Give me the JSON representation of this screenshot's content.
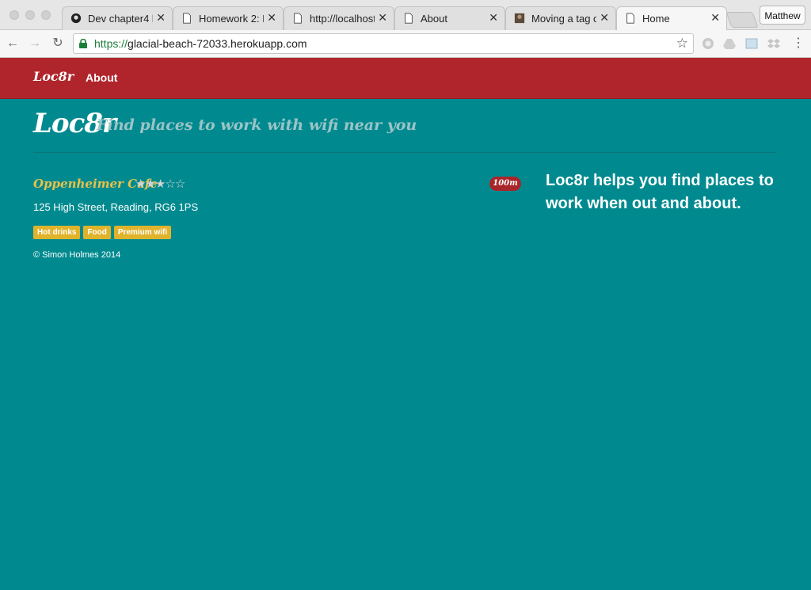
{
  "browser": {
    "tabs": [
      {
        "title": "Dev chapter4 b",
        "icon": "github-icon"
      },
      {
        "title": "Homework 2: M",
        "icon": "page-icon"
      },
      {
        "title": "http://localhost",
        "icon": "page-icon"
      },
      {
        "title": "About",
        "icon": "page-icon"
      },
      {
        "title": "Moving a tag o",
        "icon": "avatar-icon"
      },
      {
        "title": "Home",
        "icon": "page-icon",
        "active": true
      }
    ],
    "profile_name": "Matthew",
    "url_scheme": "https://",
    "url_host": "glacial-beach-72033.herokuapp.com"
  },
  "navbar": {
    "brand": "Loc8r",
    "links": [
      "About"
    ]
  },
  "header": {
    "title": "Loc8r",
    "tagline": "Find places to work with wifi near you"
  },
  "location": {
    "name": "Oppenheimer Cafe",
    "rating": 3,
    "rating_max": 5,
    "distance": "100m",
    "address": "125 High Street, Reading, RG6 1PS",
    "facilities": [
      "Hot drinks",
      "Food",
      "Premium wifi"
    ]
  },
  "footer": "© Simon Holmes 2014",
  "sidebar": {
    "text": "Loc8r helps you find places to work when out and about."
  },
  "colors": {
    "navbar": "#b0252b",
    "body": "#008a8f",
    "accent": "#e8c24a",
    "badge": "#e0b32d"
  }
}
